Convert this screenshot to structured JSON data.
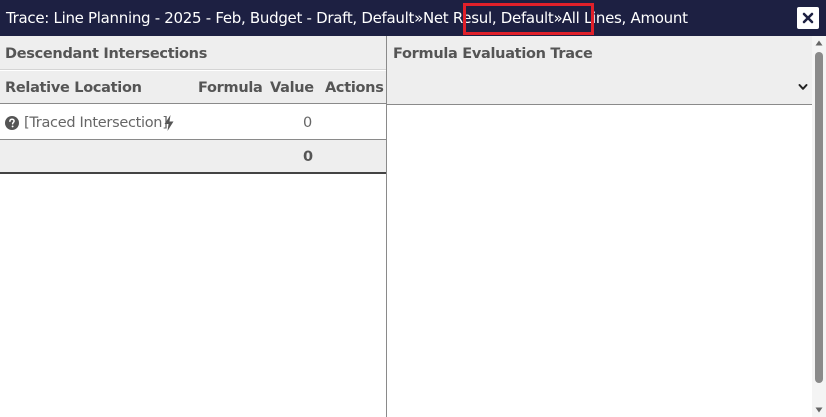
{
  "dialog": {
    "title_prefix": "Trace: Line Planning - 2025 - Feb, Budget - Draft, Default»Net Resul",
    "title_highlight": ", Default»All Lines,",
    "title_suffix": " Amount",
    "close_icon": "close-icon"
  },
  "left_pane": {
    "title": "Descendant Intersections",
    "columns": {
      "relative_location": "Relative Location",
      "formula": "Formula",
      "value": "Value",
      "actions": "Actions"
    },
    "rows": [
      {
        "help_icon": "question-circle-icon",
        "location": "[Traced Intersection]",
        "bolt_icon": "lightning-bolt-icon",
        "formula": "",
        "value": "0",
        "actions": ""
      }
    ],
    "total": {
      "value": "0"
    }
  },
  "right_pane": {
    "title": "Formula Evaluation Trace",
    "dropdown_icon": "chevron-down-icon"
  },
  "colors": {
    "titlebar_bg": "#1d2042",
    "highlight": "#e0202a",
    "header_bg": "#eeeeee"
  }
}
